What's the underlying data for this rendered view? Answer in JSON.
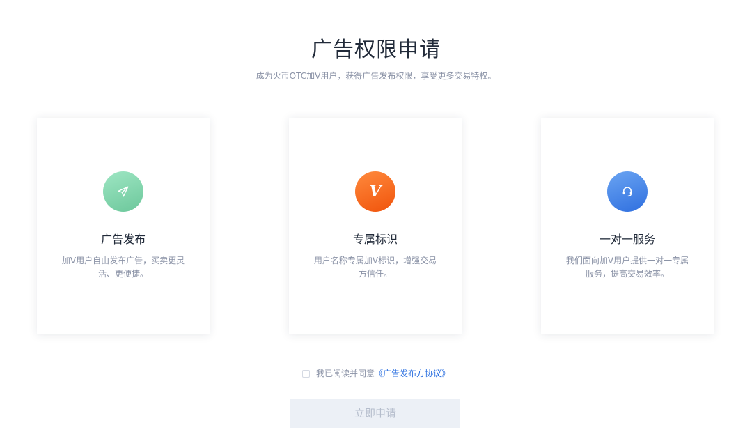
{
  "header": {
    "title": "广告权限申请",
    "subtitle": "成为火币OTC加V用户，获得广告发布权限，享受更多交易特权。"
  },
  "cards": [
    {
      "icon": "paper-plane-icon",
      "icon_color": "#7fd5aa",
      "title": "广告发布",
      "description": "加V用户自由发布广告，买卖更灵活、更便捷。"
    },
    {
      "icon": "v-badge-icon",
      "icon_text": "V",
      "icon_color": "#f5640f",
      "title": "专属标识",
      "description": "用户名称专属加V标识，增强交易方信任。"
    },
    {
      "icon": "headset-icon",
      "icon_color": "#3b7de6",
      "title": "一对一服务",
      "description": "我们面向加V用户提供一对一专属服务，提高交易效率。"
    }
  ],
  "agreement": {
    "checked": false,
    "label": "我已阅读并同意",
    "link_text": "《广告发布方协议》"
  },
  "apply_button": {
    "label": "立即申请",
    "disabled": true
  },
  "colors": {
    "link": "#2a6fe0",
    "button_disabled_bg": "#ecf0f6",
    "button_disabled_text": "#b5bdcc"
  }
}
